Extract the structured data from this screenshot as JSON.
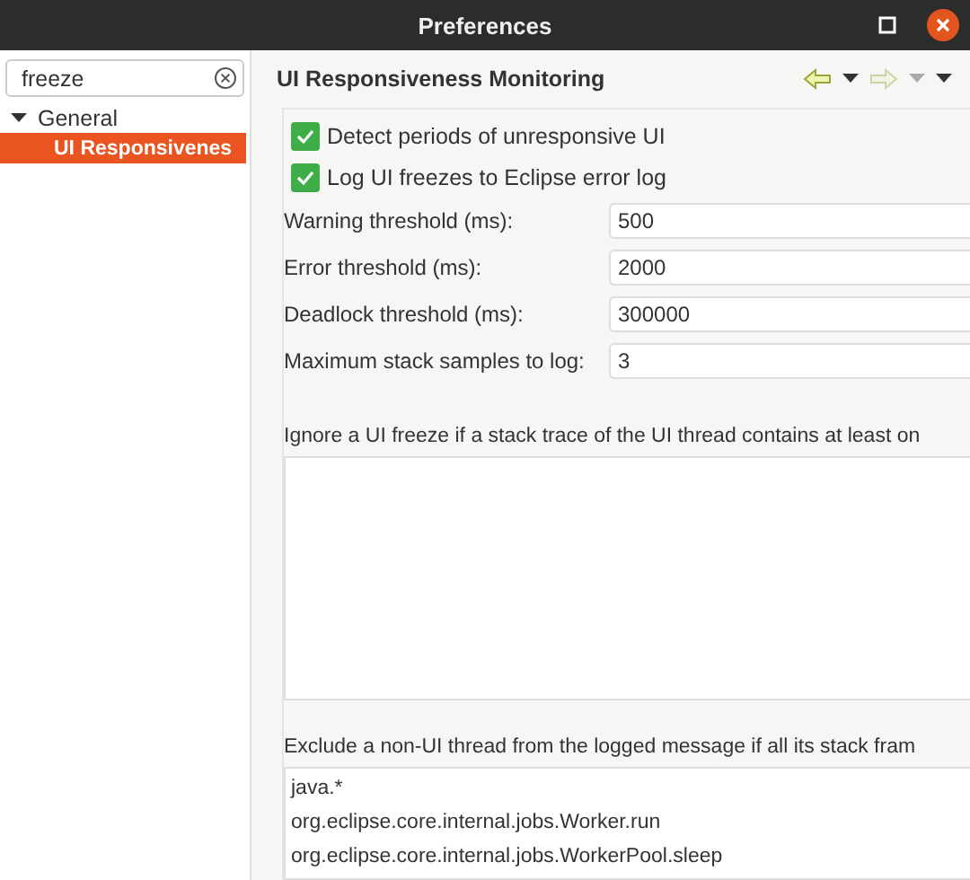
{
  "window": {
    "title": "Preferences"
  },
  "search": {
    "value": "freeze"
  },
  "tree": [
    {
      "label": "General",
      "expanded": true,
      "selected": false,
      "children": [
        {
          "label": "UI Responsivenes",
          "selected": true
        }
      ]
    }
  ],
  "page": {
    "title": "UI Responsiveness Monitoring"
  },
  "options": [
    {
      "label": "Detect periods of unresponsive UI",
      "checked": true
    },
    {
      "label": "Log UI freezes to Eclipse error log",
      "checked": true
    }
  ],
  "fields": [
    {
      "label": "Warning threshold (ms):",
      "value": "500"
    },
    {
      "label": "Error threshold (ms):",
      "value": "2000"
    },
    {
      "label": "Deadlock threshold (ms):",
      "value": "300000"
    },
    {
      "label": "Maximum stack samples to log:",
      "value": "3"
    }
  ],
  "ignore": {
    "label": "Ignore a UI freeze if a stack trace of the UI thread contains at least on"
  },
  "exclude": {
    "label": "Exclude a non-UI thread from the logged message if all its stack fram",
    "items": [
      "java.*",
      "org.eclipse.core.internal.jobs.Worker.run",
      "org.eclipse.core.internal.jobs.WorkerPool.sleep"
    ]
  }
}
